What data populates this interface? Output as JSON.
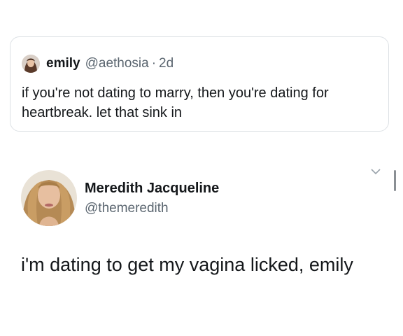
{
  "quoted_tweet": {
    "display_name": "emily",
    "handle": "@aethosia",
    "separator": "·",
    "age": "2d",
    "text": "if you're not dating to marry, then you're dating for heartbreak. let that sink in"
  },
  "reply_tweet": {
    "display_name": "Meredith Jacqueline",
    "handle": "@themeredith",
    "text": "i'm dating to get my vagina licked, emily"
  },
  "icons": {
    "more_options": "chevron-down-icon"
  },
  "colors": {
    "primary_text": "#14171a",
    "secondary_text": "#5b6670",
    "card_border": "#dde1e5",
    "background": "#ffffff"
  }
}
